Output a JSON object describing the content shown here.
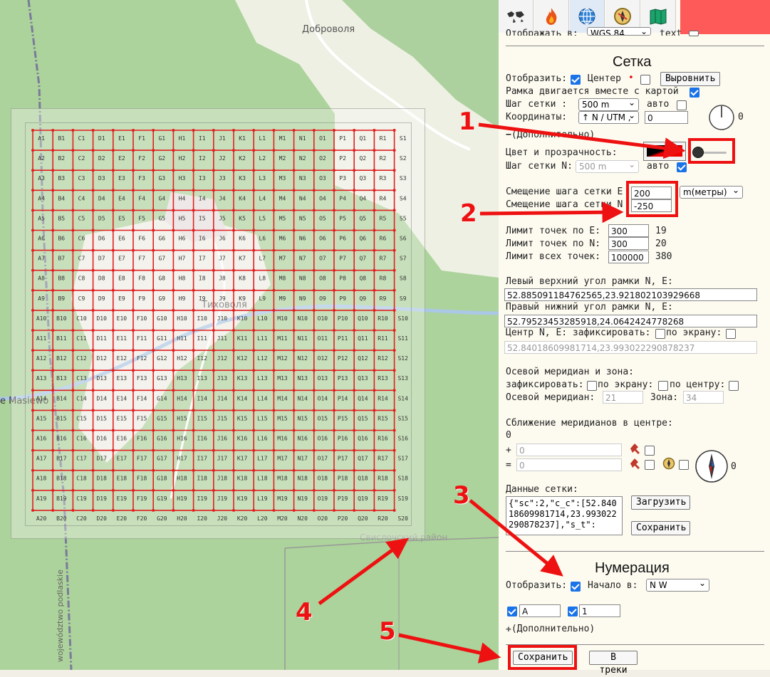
{
  "map": {
    "places": [
      "Доброволя",
      "Тиховоля",
      "e Masiewo",
      "Свислочский район",
      "województwo podlaskie"
    ],
    "grid": {
      "cols": [
        "A",
        "B",
        "C",
        "D",
        "E",
        "F",
        "G",
        "H",
        "I",
        "J",
        "K",
        "L",
        "M",
        "N",
        "O",
        "P",
        "Q",
        "R",
        "S"
      ],
      "rows": 20,
      "line_color": "#e02020"
    }
  },
  "tabs": [
    "world-map-icon",
    "fire-icon",
    "globe-grid-icon",
    "compass-icon",
    "book-map-icon"
  ],
  "top_row": {
    "label": "Отображать в:",
    "select": "WGS 84",
    "text_label": "text"
  },
  "grid_section": {
    "title": "Сетка",
    "show_label": "Отобразить:",
    "center_label": "Центер",
    "center_dot": "•",
    "align_button": "Выровнить",
    "frame_moves_label": "Рамка двигается вместе с картой",
    "step_label": "Шаг сетки :",
    "step_value": "500 m",
    "auto_label": "авто",
    "coords_label": "Координаты:",
    "coords_value": "↑ N / UTM ,",
    "coords_input": "0",
    "angle_value": "0",
    "more_label": "(Дополнительно)",
    "color_label": "Цвет и прозрачность:",
    "stepN_label": "Шаг сетки N:",
    "stepN_value": "500 m",
    "offsetE_label": "Смещение шага сетки E",
    "offsetE_value": "200",
    "offsetN_label": "Смещение шага сетки N",
    "offsetN_value": "-250",
    "unit_value": "m(метры)",
    "limitE_label": "Лимит точек по E:",
    "limitE_value": "300",
    "limitE_count": "19",
    "limitN_label": "Лимит точек по N:",
    "limitN_value": "300",
    "limitN_count": "20",
    "limitAll_label": "Лимит всех точек:",
    "limitAll_value": "100000",
    "limitAll_count": "380",
    "topleft_label": "Левый верхний угол рамки N, E:",
    "topleft_value": "52.885091184762565,23.921802103929668",
    "bottomright_label": "Правый нижний угол рамки N, E:",
    "bottomright_value": "52.79523453285918,24.0642424778268",
    "center_ne_label": "Центр N, E: зафиксировать:",
    "by_screen_label": "по экрану:",
    "center_value": "52.84018609981714,23.993022290878237",
    "meridian_title": "Осевой меридиан и зона:",
    "fix_label": "зафиксировать:",
    "by_screen2": "по экрану:",
    "by_center": "по центру:",
    "meridian_label": "Осевой меридиан:",
    "meridian_value": "21",
    "zone_label": "Зона:",
    "zone_value": "34",
    "convergence_label": "Сближение меридианов в центре:",
    "convergence_value": "0",
    "plus_sign": "+",
    "eq_sign": "=",
    "plus_value": "0",
    "eq_value": "0",
    "compass_value": "0",
    "data_label": "Данные сетки:",
    "data_text": "{\"sc\":2,\"c_c\":[52.84018609981714,23.993022290878237],\"s_t\":",
    "load_button": "Загрузить",
    "save_button": "Сохранить"
  },
  "numbering": {
    "title": "Нумерация",
    "show_label": "Отобразить:",
    "start_label": "Начало в:",
    "start_value": "N W",
    "letter_value": "A",
    "number_value": "1",
    "more_label": "(Дополнительно)"
  },
  "footer": {
    "save_button": "Сохранить",
    "tracks_button": "В треки"
  },
  "callouts": [
    "1",
    "2",
    "3",
    "4",
    "5"
  ]
}
